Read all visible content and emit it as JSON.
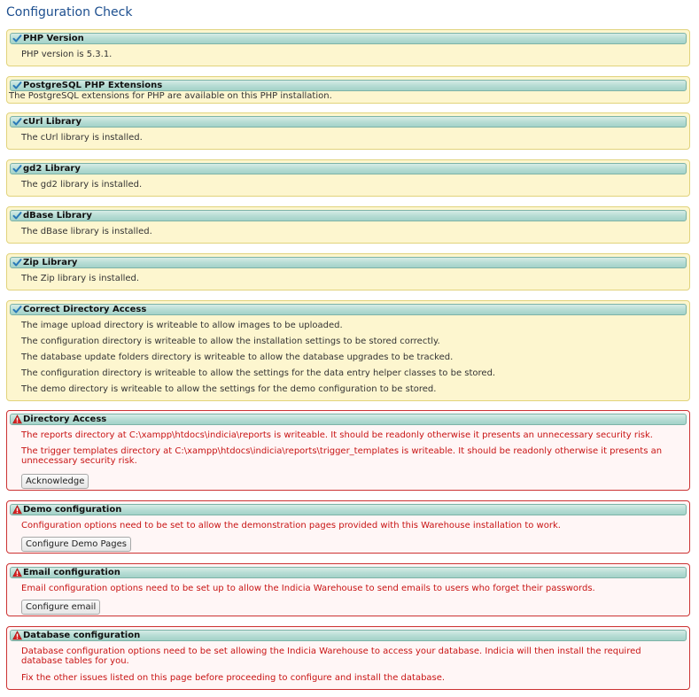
{
  "page": {
    "title": "Configuration Check"
  },
  "colors": {
    "title": "#1d4f8f",
    "ok_panel_bg": "#fdf6cf",
    "err_panel_bg": "#fff6f6",
    "err_border": "#cc3333",
    "err_text": "#c81414",
    "header_bg": "#b8ddd5",
    "check": "#2a7ab8",
    "warning": "#d92020"
  },
  "checks": [
    {
      "title": "PHP Version",
      "icon": "check-icon",
      "messages": [
        "PHP version is 5.3.1."
      ]
    },
    {
      "title": "PostgreSQL PHP Extensions",
      "icon": "check-icon",
      "messages": [
        "The PostgreSQL extensions for PHP are available on this PHP installation."
      ]
    },
    {
      "title": "cUrl Library",
      "icon": "check-icon",
      "messages": [
        "The cUrl library is installed."
      ]
    },
    {
      "title": "gd2 Library",
      "icon": "check-icon",
      "messages": [
        "The gd2 library is installed."
      ]
    },
    {
      "title": "dBase Library",
      "icon": "check-icon",
      "messages": [
        "The dBase library is installed."
      ]
    },
    {
      "title": "Zip Library",
      "icon": "check-icon",
      "messages": [
        "The Zip library is installed."
      ]
    },
    {
      "title": "Correct Directory Access",
      "icon": "check-icon",
      "messages": [
        "The image upload directory is writeable to allow images to be uploaded.",
        "The configuration directory is writeable to allow the installation settings to be stored correctly.",
        "The database update folders directory is writeable to allow the database upgrades to be tracked.",
        "The configuration directory is writeable to allow the settings for the data entry helper classes to be stored.",
        "The demo directory is writeable to allow the settings for the demo configuration to be stored."
      ]
    }
  ],
  "issues": [
    {
      "title": "Directory Access",
      "icon": "warning-icon",
      "messages": [
        "The reports directory at C:\\xampp\\htdocs\\indicia\\reports is writeable. It should be readonly otherwise it presents an unnecessary security risk.",
        "The trigger templates directory at C:\\xampp\\htdocs\\indicia\\reports\\trigger_templates is writeable. It should be readonly otherwise it presents an unnecessary security risk."
      ],
      "button": "Acknowledge"
    },
    {
      "title": "Demo configuration",
      "icon": "warning-icon",
      "messages": [
        "Configuration options need to be set to allow the demonstration pages provided with this Warehouse installation to work."
      ],
      "button": "Configure Demo Pages"
    },
    {
      "title": "Email configuration",
      "icon": "warning-icon",
      "messages": [
        "Email configuration options need to be set up to allow the Indicia Warehouse to send emails to users who forget their passwords."
      ],
      "button": "Configure email"
    },
    {
      "title": "Database configuration",
      "icon": "warning-icon",
      "messages": [
        "Database configuration options need to be set allowing the Indicia Warehouse to access your database. Indicia will then install the required database tables for you.",
        "Fix the other issues listed on this page before proceeding to configure and install the database."
      ]
    }
  ]
}
